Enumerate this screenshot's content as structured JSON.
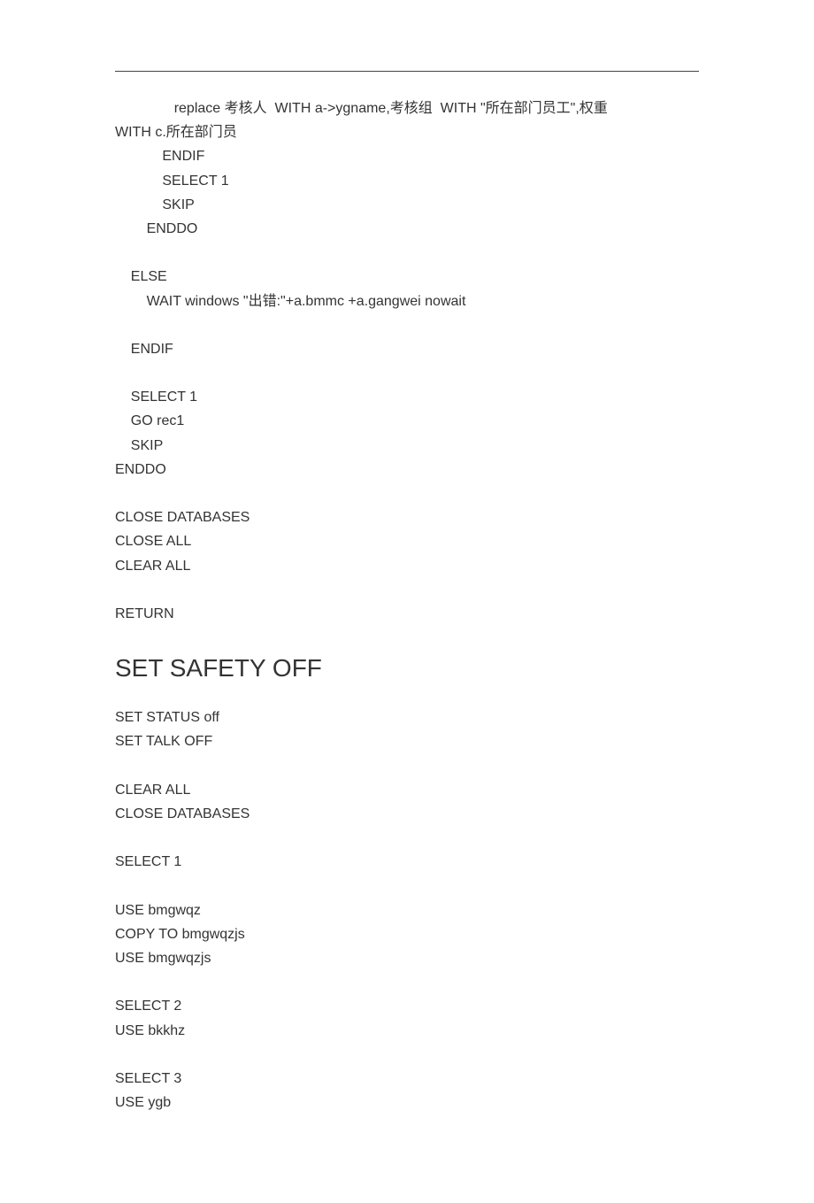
{
  "block1": {
    "l1": "               replace 考核人  WITH a->ygname,考核组  WITH \"所在部门员工\",权重",
    "l2": "WITH c.所在部门员",
    "l3": "            ENDIF",
    "l4": "            SELECT 1",
    "l5": "            SKIP",
    "l6": "        ENDDO",
    "l7": "",
    "l8": "    ELSE",
    "l9": "        WAIT windows \"出错:\"+a.bmmc +a.gangwei nowait",
    "l10": "",
    "l11": "    ENDIF",
    "l12": "",
    "l13": "    SELECT 1",
    "l14": "    GO rec1",
    "l15": "    SKIP",
    "l16": "ENDDO",
    "l17": "",
    "l18": "CLOSE DATABASES",
    "l19": "CLOSE ALL",
    "l20": "CLEAR ALL",
    "l21": "",
    "l22": "RETURN"
  },
  "heading": "SET SAFETY OFF",
  "block2": {
    "l1": "SET STATUS off",
    "l2": "SET TALK OFF",
    "l3": "",
    "l4": "CLEAR ALL",
    "l5": "CLOSE DATABASES",
    "l6": "",
    "l7": "SELECT 1",
    "l8": "",
    "l9": "USE bmgwqz",
    "l10": "COPY TO bmgwqzjs",
    "l11": "USE bmgwqzjs",
    "l12": "",
    "l13": "SELECT 2",
    "l14": "USE bkkhz",
    "l15": "",
    "l16": "SELECT 3",
    "l17": "USE ygb"
  }
}
